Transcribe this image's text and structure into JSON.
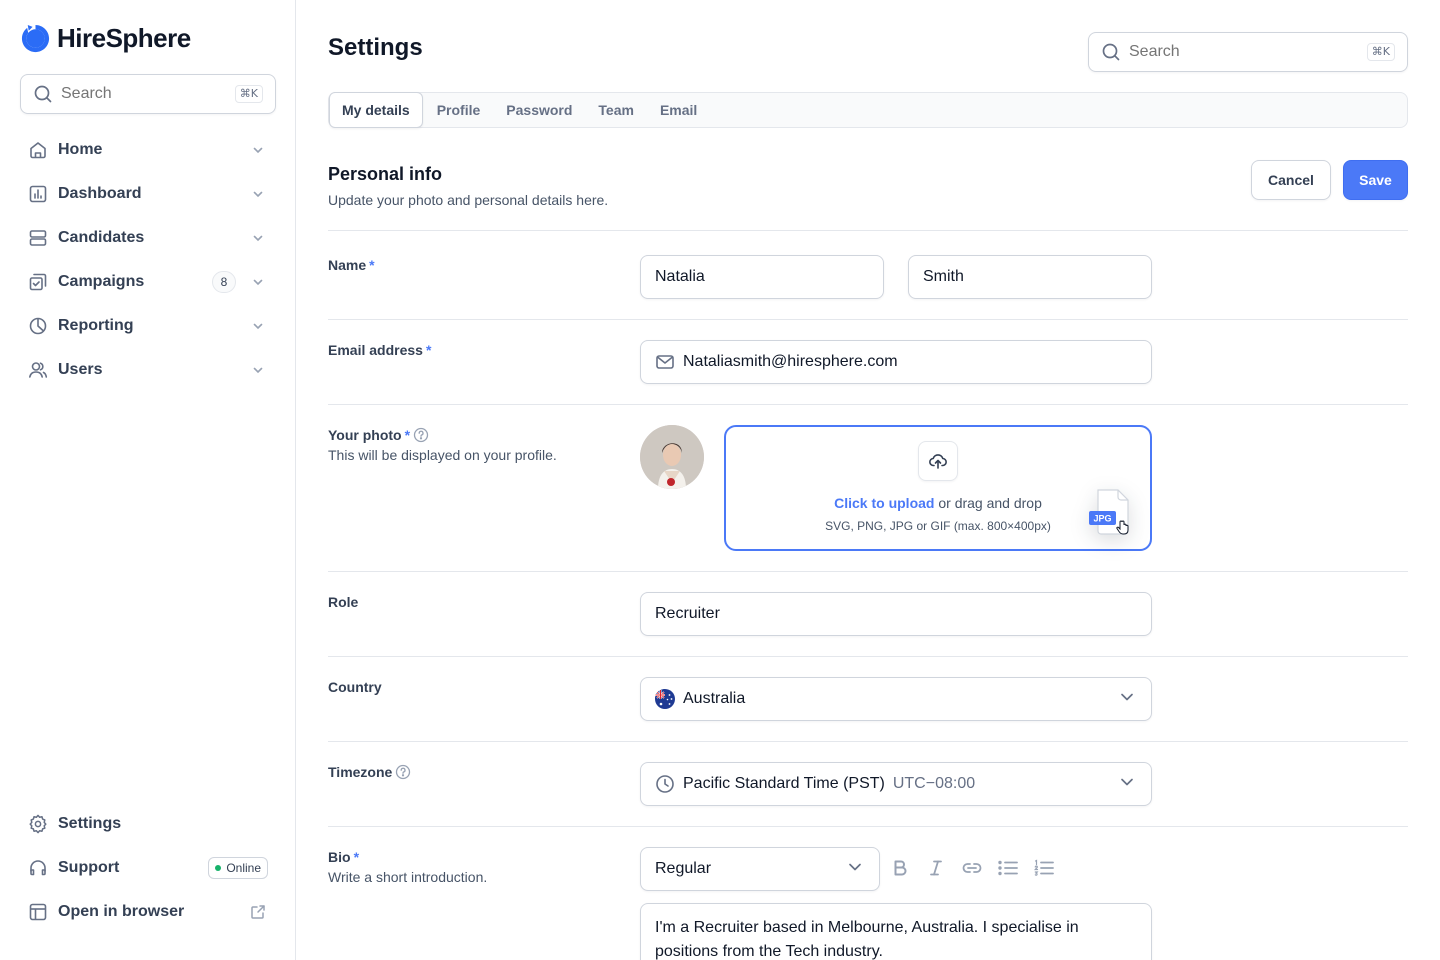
{
  "app": {
    "name": "HireSphere"
  },
  "sidebar": {
    "search": {
      "placeholder": "Search",
      "shortcut": "⌘K"
    },
    "items": [
      {
        "label": "Home",
        "icon": "home-icon"
      },
      {
        "label": "Dashboard",
        "icon": "bar-chart-icon"
      },
      {
        "label": "Candidates",
        "icon": "layers-icon"
      },
      {
        "label": "Campaigns",
        "icon": "check-square-icon",
        "badge": "8"
      },
      {
        "label": "Reporting",
        "icon": "pie-chart-icon"
      },
      {
        "label": "Users",
        "icon": "users-icon"
      }
    ],
    "bottom": [
      {
        "label": "Settings",
        "icon": "gear-icon"
      },
      {
        "label": "Support",
        "icon": "headset-icon",
        "status": "Online"
      },
      {
        "label": "Open in browser",
        "icon": "browser-icon"
      }
    ]
  },
  "header": {
    "title": "Settings",
    "search": {
      "placeholder": "Search",
      "shortcut": "⌘K"
    }
  },
  "tabs": [
    "My details",
    "Profile",
    "Password",
    "Team",
    "Email"
  ],
  "personal_info": {
    "title": "Personal info",
    "subtitle": "Update your photo and personal details here.",
    "cancel_label": "Cancel",
    "save_label": "Save"
  },
  "form": {
    "name": {
      "label": "Name",
      "required": "*",
      "first": "Natalia",
      "last": "Smith"
    },
    "email": {
      "label": "Email address",
      "required": "*",
      "value": "Nataliasmith@hiresphere.com"
    },
    "photo": {
      "label": "Your photo",
      "required": "*",
      "help": "This will be displayed on your profile.",
      "upload_link": "Click to upload",
      "upload_rest": " or drag and drop",
      "upload_hint": "SVG, PNG, JPG or GIF (max. 800×400px)",
      "file_tag": "JPG"
    },
    "role": {
      "label": "Role",
      "value": "Recruiter"
    },
    "country": {
      "label": "Country",
      "value": "Australia"
    },
    "timezone": {
      "label": "Timezone",
      "value": "Pacific Standard Time (PST)",
      "offset": "UTC−08:00"
    },
    "bio": {
      "label": "Bio",
      "required": "*",
      "help": "Write a short introduction.",
      "style": "Regular",
      "text": "I'm a Recruiter based in Melbourne, Australia. I specialise in positions from the Tech industry."
    }
  },
  "colors": {
    "accent": "#4b79f7",
    "border": "#d0d5dd",
    "text": "#101828",
    "online": "#17b26a"
  }
}
